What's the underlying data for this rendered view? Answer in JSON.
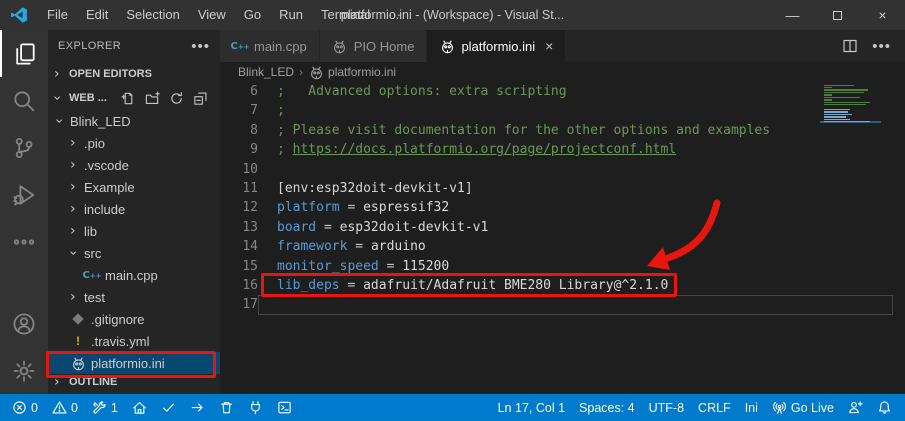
{
  "window": {
    "title": "platformio.ini - (Workspace) - Visual St...",
    "menus": [
      "File",
      "Edit",
      "Selection",
      "View",
      "Go",
      "Run",
      "Terminal"
    ],
    "menu_more": "···"
  },
  "activity_bar": [
    {
      "name": "explorer",
      "icon": "files-icon",
      "active": true
    },
    {
      "name": "search",
      "icon": "search-icon"
    },
    {
      "name": "source-control",
      "icon": "git-branch-icon"
    },
    {
      "name": "run-debug",
      "icon": "debug-icon"
    },
    {
      "name": "more-views",
      "icon": "ellipsis-icon"
    },
    {
      "name": "account",
      "icon": "account-icon",
      "bottom": true
    },
    {
      "name": "settings",
      "icon": "gear-icon",
      "bottom": true
    }
  ],
  "sidebar": {
    "title": "EXPLORER",
    "sections": {
      "open_editors": "OPEN EDITORS",
      "workspace": "WEB ...",
      "outline": "OUTLINE"
    },
    "workspace_actions": [
      "new-file-icon",
      "new-folder-icon",
      "refresh-icon",
      "collapse-all-icon"
    ],
    "tree": [
      {
        "label": "Blink_LED",
        "indent": 0,
        "chevron": "down"
      },
      {
        "label": ".pio",
        "indent": 1,
        "chevron": "right"
      },
      {
        "label": ".vscode",
        "indent": 1,
        "chevron": "right"
      },
      {
        "label": "Example",
        "indent": 1,
        "chevron": "right"
      },
      {
        "label": "include",
        "indent": 1,
        "chevron": "right"
      },
      {
        "label": "lib",
        "indent": 1,
        "chevron": "right"
      },
      {
        "label": "src",
        "indent": 1,
        "chevron": "down"
      },
      {
        "label": "main.cpp",
        "indent": 2,
        "icon": "cpp"
      },
      {
        "label": "test",
        "indent": 1,
        "chevron": "right"
      },
      {
        "label": ".gitignore",
        "indent": 1,
        "icon": "diamond"
      },
      {
        "label": ".travis.yml",
        "indent": 1,
        "icon": "excl"
      },
      {
        "label": "platformio.ini",
        "indent": 1,
        "icon": "pio",
        "selected": true,
        "annotated": true
      }
    ]
  },
  "tabs": [
    {
      "label": "main.cpp",
      "icon": "cpp"
    },
    {
      "label": "PIO Home",
      "icon": "pio"
    },
    {
      "label": "platformio.ini",
      "icon": "pio",
      "active": true,
      "close": "×"
    }
  ],
  "breadcrumb": [
    {
      "label": "Blink_LED"
    },
    {
      "label": "platformio.ini",
      "icon": "pio"
    }
  ],
  "editor": {
    "lines": [
      {
        "num": "6",
        "tokens": [
          {
            "t": ";   Advanced options: extra scripting",
            "c": "comment"
          }
        ]
      },
      {
        "num": "7",
        "tokens": [
          {
            "t": ";",
            "c": "comment"
          }
        ]
      },
      {
        "num": "8",
        "tokens": [
          {
            "t": "; Please visit documentation for the other options and examples",
            "c": "comment"
          }
        ]
      },
      {
        "num": "9",
        "tokens": [
          {
            "t": "; ",
            "c": "comment"
          },
          {
            "t": "https://docs.platformio.org/page/projectconf.html",
            "c": "comment link"
          }
        ]
      },
      {
        "num": "10",
        "tokens": []
      },
      {
        "num": "11",
        "tokens": [
          {
            "t": "[env:esp32doit-devkit-v1]",
            "c": "plain"
          }
        ]
      },
      {
        "num": "12",
        "tokens": [
          {
            "t": "platform",
            "c": "key"
          },
          {
            "t": " = ",
            "c": "op"
          },
          {
            "t": "espressif32",
            "c": "val"
          }
        ]
      },
      {
        "num": "13",
        "tokens": [
          {
            "t": "board",
            "c": "key"
          },
          {
            "t": " = ",
            "c": "op"
          },
          {
            "t": "esp32doit-devkit-v1",
            "c": "val"
          }
        ]
      },
      {
        "num": "14",
        "tokens": [
          {
            "t": "framework",
            "c": "key"
          },
          {
            "t": " = ",
            "c": "op"
          },
          {
            "t": "arduino",
            "c": "val"
          }
        ]
      },
      {
        "num": "15",
        "tokens": [
          {
            "t": "monitor_speed",
            "c": "key"
          },
          {
            "t": " = ",
            "c": "op"
          },
          {
            "t": "115200",
            "c": "val"
          }
        ]
      },
      {
        "num": "16",
        "tokens": [
          {
            "t": "lib_deps",
            "c": "key"
          },
          {
            "t": " = ",
            "c": "op"
          },
          {
            "t": "adafruit/Adafruit BME280 Library@^2.1.0",
            "c": "val"
          }
        ],
        "annotated": true
      },
      {
        "num": "17",
        "tokens": [],
        "current": true
      }
    ]
  },
  "status_bar": {
    "left": [
      {
        "name": "problems-errors",
        "icon": "error-icon",
        "text": "0"
      },
      {
        "name": "problems-warnings",
        "icon": "warning-icon",
        "text": "0"
      },
      {
        "name": "pio-project-tasks",
        "icon": "tools-icon",
        "text": "1"
      },
      {
        "name": "pio-home",
        "icon": "home-icon"
      },
      {
        "name": "pio-build",
        "icon": "check-icon"
      },
      {
        "name": "pio-upload",
        "icon": "arrow-right-icon"
      },
      {
        "name": "pio-clean",
        "icon": "trash-icon"
      },
      {
        "name": "pio-serial-monitor",
        "icon": "plug-icon"
      },
      {
        "name": "pio-new-terminal",
        "icon": "terminal-icon"
      }
    ],
    "right": [
      {
        "name": "cursor-position",
        "text": "Ln 17, Col 1"
      },
      {
        "name": "indentation",
        "text": "Spaces: 4"
      },
      {
        "name": "encoding",
        "text": "UTF-8"
      },
      {
        "name": "eol",
        "text": "CRLF"
      },
      {
        "name": "language-mode",
        "text": "Ini"
      },
      {
        "name": "go-live",
        "icon": "broadcast-icon",
        "text": "Go Live"
      },
      {
        "name": "feedback",
        "icon": "person-add-icon"
      },
      {
        "name": "notifications",
        "icon": "bell-icon"
      }
    ]
  },
  "colors": {
    "accent": "#007acc",
    "pio_orange": "#f5822a",
    "annotation_red": "#e8170d",
    "comment_green": "#6a9955",
    "key_blue": "#569cd6",
    "selection_blue": "#094771"
  }
}
